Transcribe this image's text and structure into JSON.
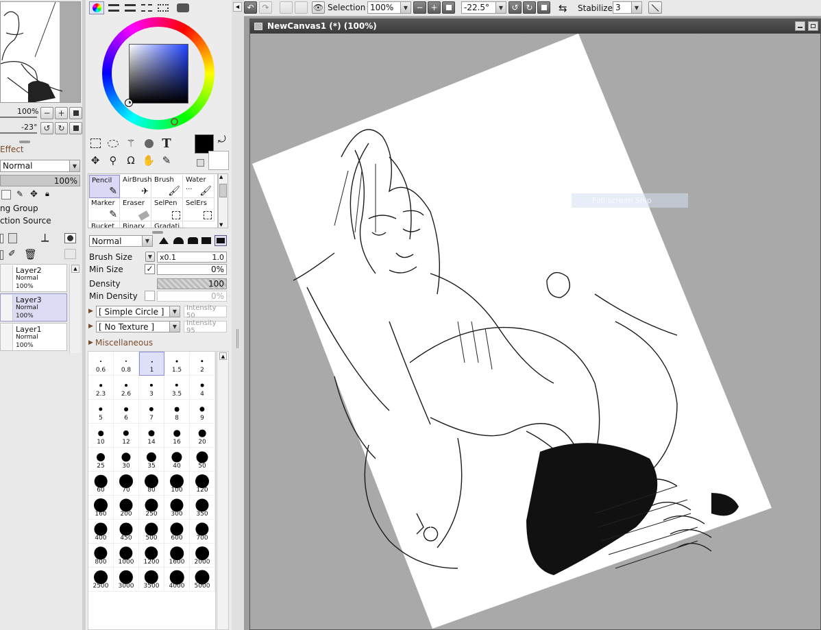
{
  "colors": {
    "accent": "#7b4a2a",
    "canvas_bg": "#a9a9a9",
    "selected": "#d9d9f5"
  },
  "navigator": {
    "zoom": "100%",
    "rotation": "-23°"
  },
  "layer_panel": {
    "effect_label": "Effect",
    "blend_mode": "Normal",
    "opacity": "100%",
    "clipping_group": "ng Group",
    "selection_source": "ction Source",
    "layers": [
      {
        "name": "Layer2",
        "mode": "Normal",
        "opacity": "100%"
      },
      {
        "name": "Layer3",
        "mode": "Normal",
        "opacity": "100%"
      },
      {
        "name": "Layer1",
        "mode": "Normal",
        "opacity": "100%"
      }
    ]
  },
  "tools": {
    "icons": [
      "rect-select-icon",
      "lasso-icon",
      "magic-wand-icon",
      "shape-select-icon",
      "text-tool-icon",
      "move-icon",
      "zoom-icon",
      "rotate-icon",
      "hand-icon",
      "eyedropper-icon"
    ],
    "text_tool_glyph": "T"
  },
  "brushes": [
    {
      "name": "Pencil"
    },
    {
      "name": "AirBrush"
    },
    {
      "name": "Brush"
    },
    {
      "name": "Water ..."
    },
    {
      "name": "Marker"
    },
    {
      "name": "Eraser"
    },
    {
      "name": "SelPen"
    },
    {
      "name": "SelErs"
    },
    {
      "name": "Bucket"
    },
    {
      "name": "Binary ..."
    },
    {
      "name": "Gradati..."
    }
  ],
  "brush_settings": {
    "blend_mode": "Normal",
    "brush_size_label": "Brush Size",
    "brush_size_mult": "x0.1",
    "brush_size_value": "1.0",
    "min_size_label": "Min Size",
    "min_size_value": "0%",
    "density_label": "Density",
    "density_value": "100",
    "min_density_label": "Min Density",
    "min_density_value": "0%",
    "shape": "[ Simple Circle ]",
    "shape_intensity": "Intensity 50",
    "texture": "[ No Texture ]",
    "texture_intensity": "Intensity 95",
    "misc_label": "Miscellaneous"
  },
  "sizes": [
    "0.6",
    "0.8",
    "1",
    "1.5",
    "2",
    "2.3",
    "2.6",
    "3",
    "3.5",
    "4",
    "5",
    "6",
    "7",
    "8",
    "9",
    "10",
    "12",
    "14",
    "16",
    "20",
    "25",
    "30",
    "35",
    "40",
    "50",
    "60",
    "70",
    "80",
    "100",
    "120",
    "160",
    "200",
    "250",
    "300",
    "350",
    "400",
    "450",
    "500",
    "600",
    "700",
    "800",
    "1000",
    "1200",
    "1600",
    "2000",
    "2500",
    "3000",
    "3500",
    "4000",
    "5000"
  ],
  "toolbar": {
    "selection_label": "Selection",
    "zoom": "100%",
    "rotation": "-22.5°",
    "stabilizer_label": "Stabilizer",
    "stabilizer_value": "3"
  },
  "canvas": {
    "title": "NewCanvas1 (*) (100%)",
    "overlay_text": "Full-screen Snip"
  }
}
